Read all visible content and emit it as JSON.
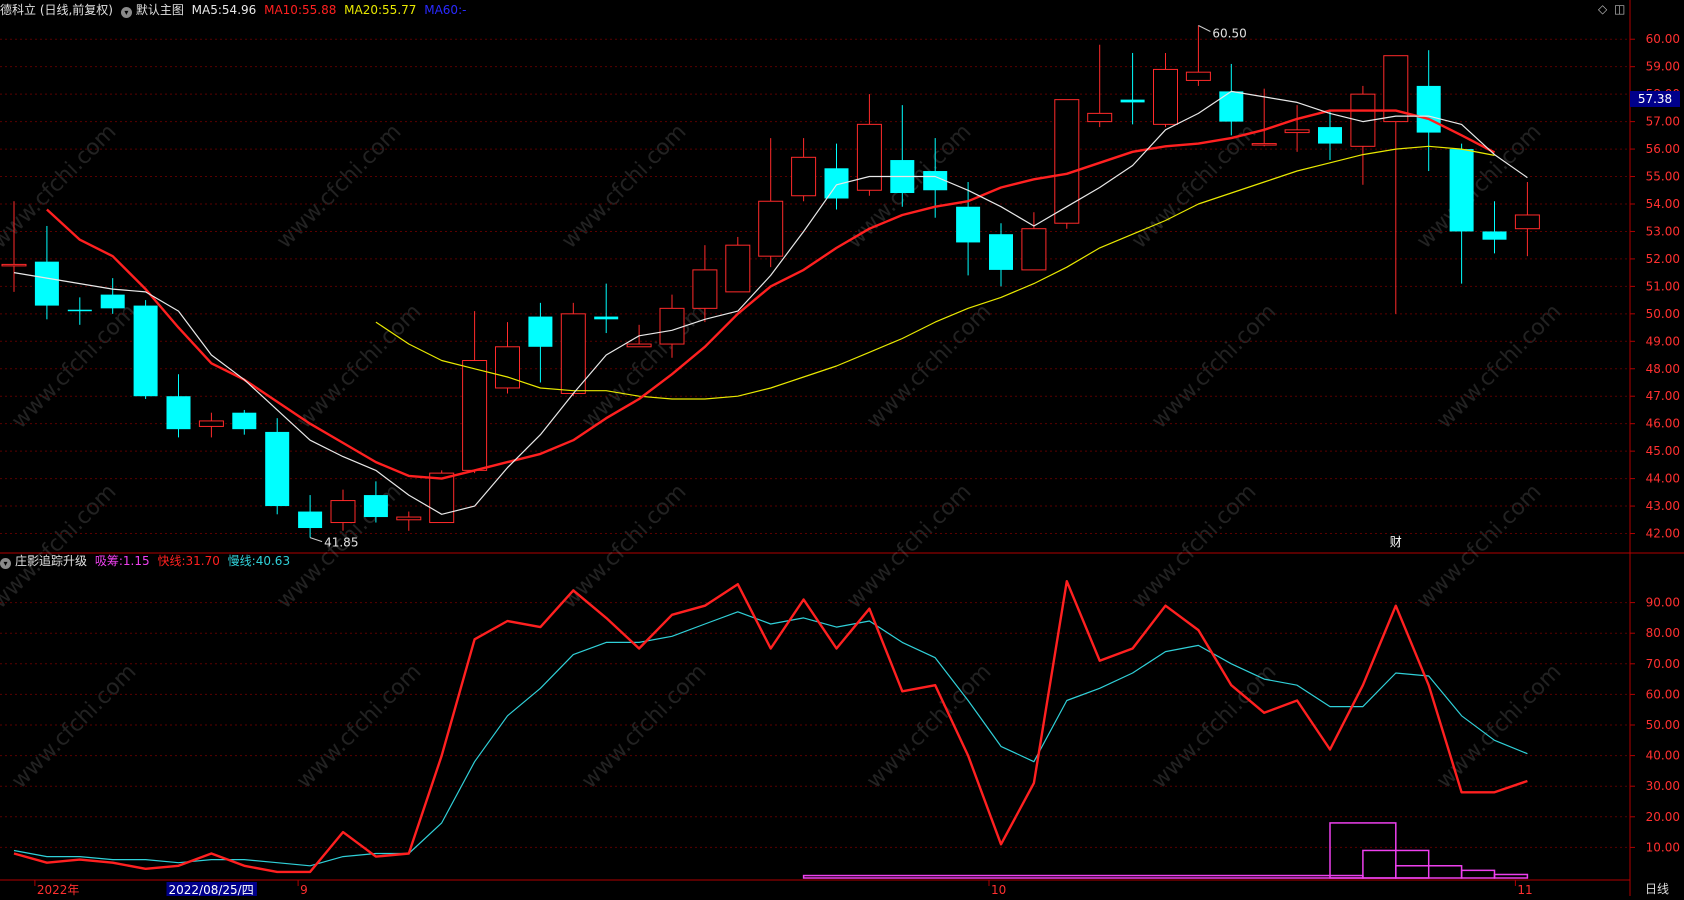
{
  "header": {
    "stock_title": "德科立 (日线,前复权)",
    "main_chart_name": "默认主图",
    "ma5_label": "MA5:",
    "ma5_value": "54.96",
    "ma10_label": "MA10:",
    "ma10_value": "55.88",
    "ma20_label": "MA20:",
    "ma20_value": "55.77",
    "ma60_label": "MA60:",
    "ma60_value": "-"
  },
  "indicator_header": {
    "name": "庄影追踪升级",
    "inflow_label": "吸筹:",
    "inflow_value": "1.15",
    "fast_label": "快线:",
    "fast_value": "31.70",
    "slow_label": "慢线:",
    "slow_value": "40.63"
  },
  "annotations": {
    "high_label": "60.50",
    "low_label": "41.85",
    "finance_marker": "财"
  },
  "last_price_box": "57.38",
  "period_button": "日线",
  "watermark_text": "www.cfchi.com",
  "colors": {
    "up": "#ff2a2a",
    "down": "#00ffff",
    "ma5": "#e8e8e8",
    "ma10": "#ff2020",
    "ma20": "#e8e800",
    "fast": "#ff2020",
    "slow": "#30d0d8",
    "inflow": "#ee40ee",
    "grid": "#5a0000"
  },
  "chart_data": [
    {
      "type": "candlestick",
      "title": "德科立 (日线,前复权)",
      "ylim": [
        41.4,
        60.7
      ],
      "y_ticks": [
        "60.00",
        "59.00",
        "58.00",
        "57.00",
        "56.00",
        "55.00",
        "54.00",
        "53.00",
        "52.00",
        "51.00",
        "50.00",
        "49.00",
        "48.00",
        "47.00",
        "46.00",
        "45.00",
        "44.00",
        "43.00",
        "42.00"
      ],
      "x_labels": [
        {
          "label": "2022年",
          "index": 1
        },
        {
          "label": "2022/08/25/四",
          "index": 5,
          "highlight": true
        },
        {
          "label": "9",
          "index": 9
        },
        {
          "label": "10",
          "index": 30
        },
        {
          "label": "11",
          "index": 46
        }
      ],
      "candles": [
        {
          "o": 51.8,
          "c": 51.8,
          "h": 54.1,
          "l": 50.8
        },
        {
          "o": 51.9,
          "c": 50.3,
          "h": 53.2,
          "l": 49.8
        },
        {
          "o": 50.15,
          "c": 50.1,
          "h": 50.6,
          "l": 49.6
        },
        {
          "o": 50.7,
          "c": 50.2,
          "h": 51.3,
          "l": 50.0
        },
        {
          "o": 50.3,
          "c": 47.0,
          "h": 50.5,
          "l": 46.9
        },
        {
          "o": 47.0,
          "c": 45.8,
          "h": 47.8,
          "l": 45.5
        },
        {
          "o": 45.9,
          "c": 46.1,
          "h": 46.4,
          "l": 45.5
        },
        {
          "o": 46.4,
          "c": 45.8,
          "h": 46.5,
          "l": 45.6
        },
        {
          "o": 45.7,
          "c": 43.0,
          "h": 46.2,
          "l": 42.7
        },
        {
          "o": 42.8,
          "c": 42.2,
          "h": 43.4,
          "l": 41.85
        },
        {
          "o": 42.4,
          "c": 43.2,
          "h": 43.6,
          "l": 42.1
        },
        {
          "o": 43.4,
          "c": 42.6,
          "h": 43.9,
          "l": 42.4
        },
        {
          "o": 42.5,
          "c": 42.6,
          "h": 42.8,
          "l": 42.1
        },
        {
          "o": 42.4,
          "c": 44.2,
          "h": 44.3,
          "l": 42.4
        },
        {
          "o": 44.3,
          "c": 48.3,
          "h": 50.1,
          "l": 44.2
        },
        {
          "o": 47.3,
          "c": 48.8,
          "h": 49.7,
          "l": 47.1
        },
        {
          "o": 49.9,
          "c": 48.8,
          "h": 50.4,
          "l": 47.5
        },
        {
          "o": 47.1,
          "c": 50.0,
          "h": 50.4,
          "l": 47.0
        },
        {
          "o": 49.9,
          "c": 49.8,
          "h": 51.1,
          "l": 49.3
        },
        {
          "o": 48.8,
          "c": 48.9,
          "h": 49.6,
          "l": 48.8
        },
        {
          "o": 48.9,
          "c": 50.2,
          "h": 50.7,
          "l": 48.4
        },
        {
          "o": 50.2,
          "c": 51.6,
          "h": 52.5,
          "l": 49.7
        },
        {
          "o": 50.8,
          "c": 52.5,
          "h": 52.8,
          "l": 50.8
        },
        {
          "o": 52.1,
          "c": 54.1,
          "h": 56.4,
          "l": 51.7
        },
        {
          "o": 54.3,
          "c": 55.7,
          "h": 56.4,
          "l": 54.1
        },
        {
          "o": 55.3,
          "c": 54.2,
          "h": 56.2,
          "l": 53.8
        },
        {
          "o": 54.5,
          "c": 56.9,
          "h": 58.0,
          "l": 54.3
        },
        {
          "o": 55.6,
          "c": 54.4,
          "h": 57.6,
          "l": 53.9
        },
        {
          "o": 55.2,
          "c": 54.5,
          "h": 56.4,
          "l": 53.5
        },
        {
          "o": 53.9,
          "c": 52.6,
          "h": 54.8,
          "l": 51.4
        },
        {
          "o": 52.9,
          "c": 51.6,
          "h": 53.3,
          "l": 51.0
        },
        {
          "o": 51.6,
          "c": 53.1,
          "h": 53.7,
          "l": 51.6
        },
        {
          "o": 53.3,
          "c": 57.8,
          "h": 57.8,
          "l": 53.1
        },
        {
          "o": 57.0,
          "c": 57.3,
          "h": 59.8,
          "l": 56.8
        },
        {
          "o": 57.8,
          "c": 57.7,
          "h": 59.5,
          "l": 56.9
        },
        {
          "o": 56.9,
          "c": 58.9,
          "h": 59.5,
          "l": 56.8
        },
        {
          "o": 58.5,
          "c": 58.8,
          "h": 60.5,
          "l": 58.3
        },
        {
          "o": 58.1,
          "c": 57.0,
          "h": 59.1,
          "l": 56.5
        },
        {
          "o": 56.2,
          "c": 56.2,
          "h": 58.2,
          "l": 56.1
        },
        {
          "o": 56.6,
          "c": 56.7,
          "h": 57.6,
          "l": 55.9
        },
        {
          "o": 56.8,
          "c": 56.2,
          "h": 57.4,
          "l": 55.6
        },
        {
          "o": 56.1,
          "c": 58.0,
          "h": 58.3,
          "l": 54.7
        },
        {
          "o": 57.0,
          "c": 59.4,
          "h": 59.4,
          "l": 50.0
        },
        {
          "o": 58.3,
          "c": 56.6,
          "h": 59.6,
          "l": 55.2
        },
        {
          "o": 56.0,
          "c": 53.0,
          "h": 56.2,
          "l": 51.1
        },
        {
          "o": 53.0,
          "c": 52.7,
          "h": 54.1,
          "l": 52.2
        },
        {
          "o": 53.1,
          "c": 53.6,
          "h": 54.8,
          "l": 52.1
        }
      ],
      "ma5": [
        51.5,
        51.3,
        51.1,
        50.9,
        50.8,
        50.1,
        48.5,
        47.6,
        46.5,
        45.4,
        44.8,
        44.3,
        43.4,
        42.7,
        43.0,
        44.4,
        45.6,
        47.1,
        48.5,
        49.2,
        49.4,
        49.8,
        50.1,
        51.4,
        53.0,
        54.7,
        55.0,
        55.0,
        55.0,
        54.5,
        53.9,
        53.2,
        53.9,
        54.6,
        55.4,
        56.7,
        57.3,
        58.1,
        57.9,
        57.7,
        57.3,
        57.0,
        57.2,
        57.2,
        56.9,
        55.8,
        54.96
      ],
      "ma10": [
        null,
        53.8,
        52.7,
        52.1,
        50.9,
        49.5,
        48.2,
        47.6,
        46.8,
        46.0,
        45.3,
        44.6,
        44.1,
        44.0,
        44.3,
        44.6,
        44.9,
        45.4,
        46.2,
        46.9,
        47.8,
        48.8,
        50.0,
        51.0,
        51.6,
        52.4,
        53.1,
        53.6,
        53.9,
        54.1,
        54.6,
        54.9,
        55.1,
        55.5,
        55.9,
        56.1,
        56.2,
        56.4,
        56.7,
        57.1,
        57.4,
        57.4,
        57.4,
        57.1,
        56.5,
        55.88
      ],
      "ma20": [
        null,
        null,
        null,
        null,
        null,
        null,
        null,
        null,
        null,
        null,
        null,
        49.7,
        48.9,
        48.3,
        48.0,
        47.7,
        47.3,
        47.2,
        47.2,
        47.0,
        46.9,
        46.9,
        47.0,
        47.3,
        47.7,
        48.1,
        48.6,
        49.1,
        49.7,
        50.2,
        50.6,
        51.1,
        51.7,
        52.4,
        52.9,
        53.4,
        54.0,
        54.4,
        54.8,
        55.2,
        55.5,
        55.8,
        56.0,
        56.1,
        56.0,
        55.77
      ]
    },
    {
      "type": "line",
      "title": "庄影追踪升级",
      "ylim": [
        0,
        100
      ],
      "y_ticks": [
        "90.00",
        "80.00",
        "70.00",
        "60.00",
        "50.00",
        "40.00",
        "30.00",
        "20.00",
        "10.00"
      ],
      "series": [
        {
          "name": "快线",
          "values": [
            8,
            5,
            6,
            5,
            3,
            4,
            8,
            4,
            2,
            2,
            15,
            7,
            8,
            40,
            78,
            84,
            82,
            94,
            85,
            75,
            86,
            89,
            96,
            75,
            91,
            75,
            88,
            61,
            63,
            40,
            11,
            31,
            97,
            71,
            75,
            89,
            81,
            63,
            54,
            58,
            42,
            63,
            89,
            63,
            28,
            28,
            31.7
          ]
        },
        {
          "name": "慢线",
          "values": [
            9,
            7,
            7,
            6,
            6,
            5,
            6,
            6,
            5,
            4,
            7,
            8,
            8,
            18,
            38,
            53,
            62,
            73,
            77,
            77,
            79,
            83,
            87,
            83,
            85,
            82,
            84,
            77,
            72,
            58,
            43,
            38,
            58,
            62,
            67,
            74,
            76,
            70,
            65,
            63,
            56,
            56,
            67,
            66,
            53,
            45,
            40.63
          ]
        }
      ],
      "inflow_bars": [
        {
          "start": 24,
          "end": 41,
          "value": 0.8
        },
        {
          "start": 40,
          "end": 42,
          "value": 18
        },
        {
          "start": 41,
          "end": 43,
          "value": 9
        },
        {
          "start": 42,
          "end": 44,
          "value": 4
        },
        {
          "start": 44,
          "end": 45,
          "value": 2.5
        },
        {
          "start": 45,
          "end": 46,
          "value": 1.15
        }
      ]
    }
  ]
}
